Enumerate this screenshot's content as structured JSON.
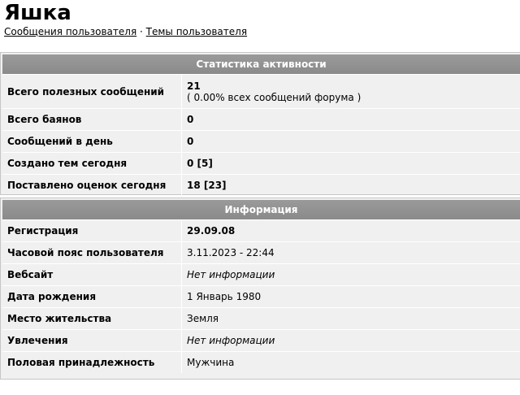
{
  "profile": {
    "username": "Яшка",
    "links": {
      "user_posts": "Сообщения пользователя",
      "separator": "·",
      "user_topics": "Темы пользователя"
    }
  },
  "stats": {
    "header": "Статистика активности",
    "rows": [
      {
        "label": "Всего полезных сообщений",
        "value": "21",
        "subtext": "( 0.00% всех сообщений форума )"
      },
      {
        "label": "Всего баянов",
        "value": "0"
      },
      {
        "label": "Сообщений в день",
        "value": "0"
      },
      {
        "label": "Создано тем сегодня",
        "value": "0 [5]"
      },
      {
        "label": "Поставлено оценок сегодня",
        "value": "18 [23]"
      }
    ]
  },
  "info": {
    "header": "Информация",
    "rows": [
      {
        "label": "Регистрация",
        "value": "29.09.08"
      },
      {
        "label": "Часовой пояс пользователя",
        "value": "3.11.2023 - 22:44"
      },
      {
        "label": "Вебсайт",
        "value": "Нет информации"
      },
      {
        "label": "Дата рождения",
        "value": "1 Январь 1980"
      },
      {
        "label": "Место жительства",
        "value": "Земля"
      },
      {
        "label": "Увлечения",
        "value": "Нет информации"
      },
      {
        "label": "Половая принадлежность",
        "value": "Мужчина"
      }
    ]
  }
}
